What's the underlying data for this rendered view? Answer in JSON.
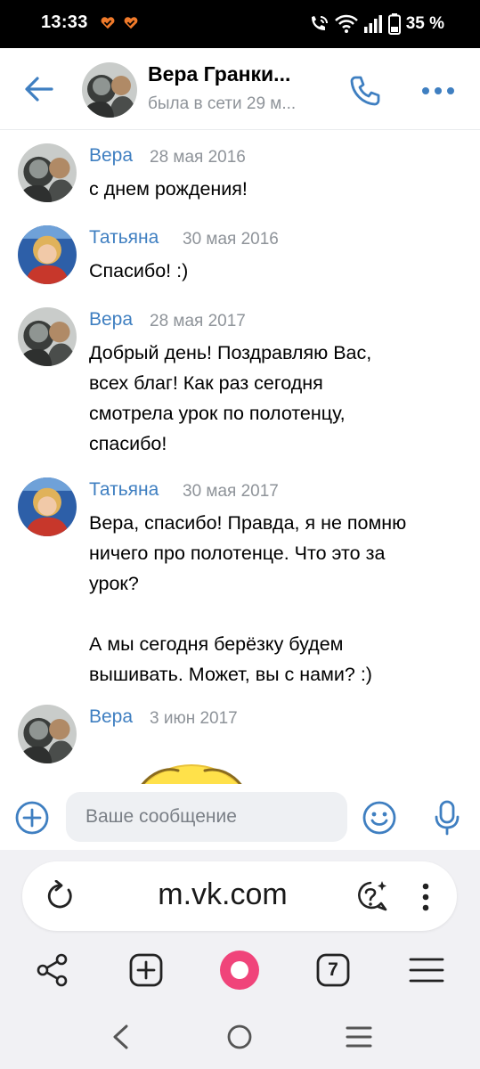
{
  "status_bar": {
    "time": "13:33",
    "battery": "35 %"
  },
  "header": {
    "name": "Вера Гранки...",
    "status": "была в сети 29 м..."
  },
  "messages": [
    {
      "author": "Вера",
      "date": "28 мая 2016",
      "text": "с днем рождения!"
    },
    {
      "author": "Татьяна",
      "date": "30 мая 2016",
      "text": "Спасибо! :)"
    },
    {
      "author": "Вера",
      "date": "28 мая 2017",
      "text": "Добрый день! Поздравляю Вас,\nвсех благ! Как раз сегодня\nсмотрела урок по полотенцу,\nспасибо!"
    },
    {
      "author": "Татьяна",
      "date": "30 мая 2017",
      "text": "Вера, спасибо! Правда, я не помню\nничего про полотенце. Что это за\nурок?\n\nА мы сегодня берёзку будем\nвышивать. Может, вы с нами? :)"
    },
    {
      "author": "Вера",
      "date": "3 июн 2017",
      "text": ""
    }
  ],
  "composer": {
    "placeholder": "Ваше сообщение"
  },
  "browser": {
    "url": "m.vk.com",
    "tabs_count": "7"
  },
  "colors": {
    "accent": "#3f7fc1",
    "secondary_text": "#8e9399",
    "alice": "#f0447a"
  }
}
